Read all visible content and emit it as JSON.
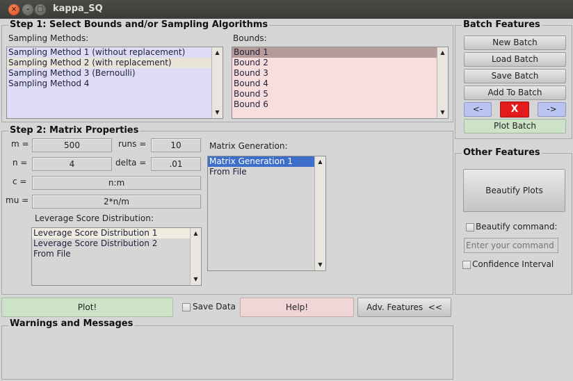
{
  "window": {
    "title": "kappa_SQ",
    "close_glyph": "×",
    "min_glyph": "–",
    "max_glyph": "□"
  },
  "step1": {
    "title": "Step 1: Select Bounds and/or Sampling Algorithms",
    "methods_label": "Sampling Methods:",
    "methods": [
      "Sampling Method 1 (without replacement)",
      "Sampling Method 2 (with replacement)",
      "Sampling Method 3 (Bernoulli)",
      "Sampling Method 4"
    ],
    "bounds_label": "Bounds:",
    "bounds": [
      "Bound 1",
      "Bound 2",
      "Bound 3",
      "Bound 4",
      "Bound 5",
      "Bound 6"
    ]
  },
  "step2": {
    "title": "Step 2: Matrix Properties",
    "m_label": "m =",
    "m_value": "500",
    "runs_label": "runs =",
    "runs_value": "10",
    "n_label": "n =",
    "n_value": "4",
    "delta_label": "delta =",
    "delta_value": ".01",
    "c_label": "c =",
    "c_value": "n:m",
    "mu_label": "mu =",
    "mu_value": "2*n/m",
    "matrix_gen_label": "Matrix Generation:",
    "matrix_gen_options": [
      "Matrix Generation 1",
      "From File"
    ],
    "leverage_label": "Leverage Score Distribution:",
    "leverage_options": [
      "Leverage Score Distribution 1",
      "Leverage Score Distribution 2",
      "From File"
    ]
  },
  "batch": {
    "title": "Batch Features",
    "new_batch": "New Batch",
    "load_batch": "Load Batch",
    "save_batch": "Save Batch",
    "add_to_batch": "Add To Batch",
    "prev": "<-",
    "delete": "X",
    "next": "->",
    "plot_batch": "Plot Batch"
  },
  "other": {
    "title": "Other Features",
    "beautify_plots": "Beautify Plots",
    "beautify_command_label": "Beautify command:",
    "command_placeholder": "Enter your command",
    "confidence_label": "Confidence Interval"
  },
  "bottom": {
    "plot": "Plot!",
    "save_data": "Save Data",
    "help": "Help!",
    "adv_features": "Adv. Features  <<"
  },
  "messages": {
    "title": "Warnings and Messages"
  },
  "icons": {
    "scroll_up": "▲",
    "scroll_down": "▼"
  },
  "colors": {
    "methods_bg": "#dedcf5",
    "bounds_bg": "#f9dede",
    "plot_green": "#cce3c7",
    "help_pink": "#f0d6d6",
    "nav_blue": "#b9c4f0",
    "delete_red": "#e31b1b",
    "list_select_blue": "#3d6ec9",
    "bound_selected": "#b59b99",
    "method_selected": "#e8e4d6"
  }
}
